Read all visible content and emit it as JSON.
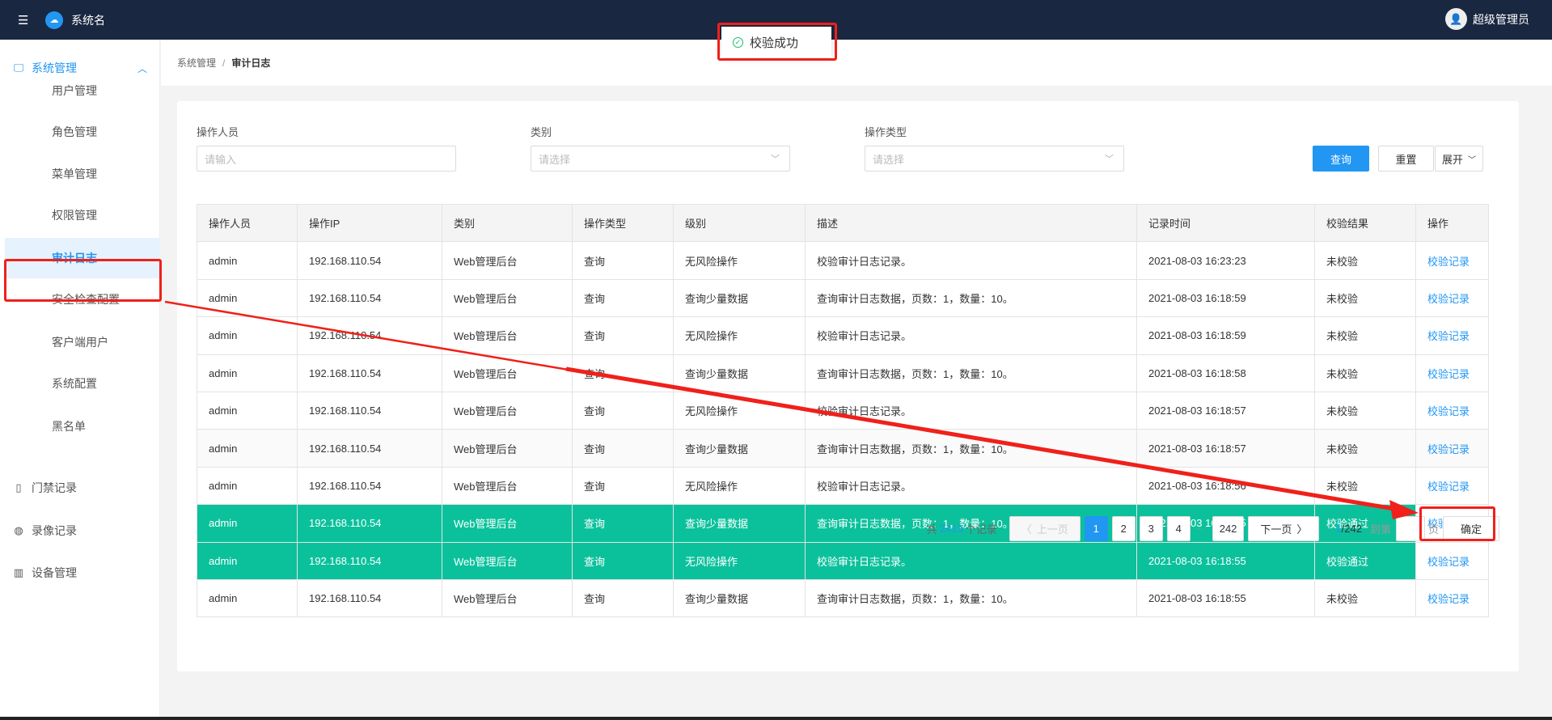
{
  "header": {
    "system_name": "系统名",
    "user_name": "超级管理员",
    "menu_icon": "menu-fold-icon",
    "logo_icon": "cloud-logo-icon"
  },
  "toast": {
    "message": "校验成功",
    "icon": "check-circle-icon"
  },
  "sidebar": {
    "group_main": {
      "label": "系统管理",
      "icon": "monitor-icon"
    },
    "items": [
      {
        "label": "用户管理"
      },
      {
        "label": "角色管理"
      },
      {
        "label": "菜单管理"
      },
      {
        "label": "权限管理"
      },
      {
        "label": "审计日志",
        "active": true
      },
      {
        "label": "安全检查配置"
      },
      {
        "label": "客户端用户"
      },
      {
        "label": "系统配置"
      },
      {
        "label": "黑名单"
      }
    ],
    "groups": [
      {
        "label": "门禁记录",
        "icon": "door-icon"
      },
      {
        "label": "录像记录",
        "icon": "video-search-icon"
      },
      {
        "label": "设备管理",
        "icon": "device-icon"
      }
    ]
  },
  "breadcrumb": {
    "parent": "系统管理",
    "current": "审计日志",
    "sep": "/"
  },
  "filters": {
    "operator": {
      "label": "操作人员",
      "placeholder": "请输入"
    },
    "category": {
      "label": "类别",
      "placeholder": "请选择"
    },
    "op_type": {
      "label": "操作类型",
      "placeholder": "请选择"
    },
    "query": "查询",
    "reset": "重置",
    "expand": "展开"
  },
  "table": {
    "columns": [
      "操作人员",
      "操作IP",
      "类别",
      "操作类型",
      "级别",
      "描述",
      "记录时间",
      "校验结果",
      "操作"
    ],
    "rows": [
      [
        "admin",
        "192.168.110.54",
        "Web管理后台",
        "查询",
        "无风险操作",
        "校验审计日志记录。",
        "2021-08-03 16:23:23",
        "未校验",
        "校验记录"
      ],
      [
        "admin",
        "192.168.110.54",
        "Web管理后台",
        "查询",
        "查询少量数据",
        "查询审计日志数据，页数：1，数量：10。",
        "2021-08-03 16:18:59",
        "未校验",
        "校验记录"
      ],
      [
        "admin",
        "192.168.110.54",
        "Web管理后台",
        "查询",
        "无风险操作",
        "校验审计日志记录。",
        "2021-08-03 16:18:59",
        "未校验",
        "校验记录"
      ],
      [
        "admin",
        "192.168.110.54",
        "Web管理后台",
        "查询",
        "查询少量数据",
        "查询审计日志数据，页数：1，数量：10。",
        "2021-08-03 16:18:58",
        "未校验",
        "校验记录"
      ],
      [
        "admin",
        "192.168.110.54",
        "Web管理后台",
        "查询",
        "无风险操作",
        "校验审计日志记录。",
        "2021-08-03 16:18:57",
        "未校验",
        "校验记录"
      ],
      [
        "admin",
        "192.168.110.54",
        "Web管理后台",
        "查询",
        "查询少量数据",
        "查询审计日志数据，页数：1，数量：10。",
        "2021-08-03 16:18:57",
        "未校验",
        "校验记录"
      ],
      [
        "admin",
        "192.168.110.54",
        "Web管理后台",
        "查询",
        "无风险操作",
        "校验审计日志记录。",
        "2021-08-03 16:18:56",
        "未校验",
        "校验记录"
      ],
      [
        "admin",
        "192.168.110.54",
        "Web管理后台",
        "查询",
        "查询少量数据",
        "查询审计日志数据，页数：1，数量：10。",
        "2021-08-03 16:18:55",
        "校验通过",
        "校验记录"
      ],
      [
        "admin",
        "192.168.110.54",
        "Web管理后台",
        "查询",
        "无风险操作",
        "校验审计日志记录。",
        "2021-08-03 16:18:55",
        "校验通过",
        "校验记录"
      ],
      [
        "admin",
        "192.168.110.54",
        "Web管理后台",
        "查询",
        "查询少量数据",
        "查询审计日志数据，页数：1，数量：10。",
        "2021-08-03 16:18:55",
        "未校验",
        "校验记录"
      ]
    ],
    "pass_color": "#0bc19c"
  },
  "pagination": {
    "total_prefix": "共",
    "total": "2413",
    "total_suffix": "个记录",
    "prev": "上一页",
    "pages": [
      "1",
      "2",
      "3",
      "4"
    ],
    "ellipsis": "···",
    "last": "242",
    "next": "下一页",
    "current": "1",
    "page_count": "/242",
    "goto_prefix": "到第",
    "goto_suffix": "页",
    "confirm": "确定"
  },
  "annotations": {
    "color": "#f0201a"
  }
}
